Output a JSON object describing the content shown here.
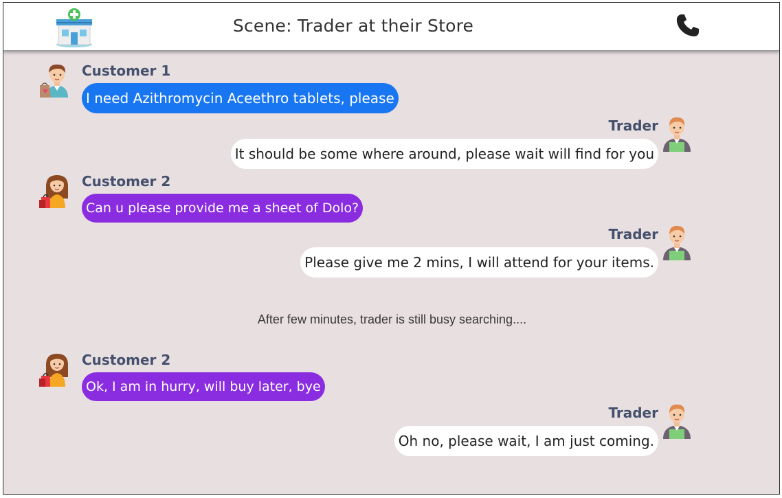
{
  "header": {
    "title": "Scene: Trader at their Store",
    "store_icon": "pharmacy-store-icon",
    "phone_icon": "phone-icon"
  },
  "colors": {
    "background": "#e8dfe1",
    "customer1_bubble": "#1876f2",
    "customer2_bubble": "#8a2ce0",
    "trader_bubble": "#ffffff",
    "name_text": "#45506d"
  },
  "messages": [
    {
      "speaker": "Customer 1",
      "role": "customer1",
      "text": "I need Azithromycin Aceethro tablets, please"
    },
    {
      "speaker": "Trader",
      "role": "trader",
      "text": "It should be some where around, please wait will find for you"
    },
    {
      "speaker": "Customer 2",
      "role": "customer2",
      "text": "Can u please provide me a sheet of Dolo?"
    },
    {
      "speaker": "Trader",
      "role": "trader",
      "text": "Please give me 2 mins, I will attend for your items."
    },
    {
      "speaker": "Customer 2",
      "role": "customer2",
      "text": "Ok, I am in hurry, will buy later, bye"
    },
    {
      "speaker": "Trader",
      "role": "trader",
      "text": "Oh no, please wait, I am just coming."
    }
  ],
  "narration": "After few minutes, trader is still busy searching...."
}
